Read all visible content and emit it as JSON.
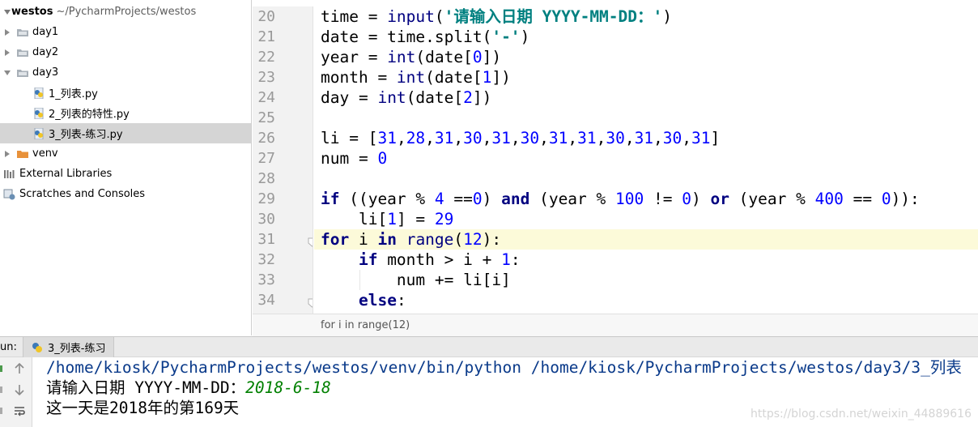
{
  "project": {
    "root_name": "westos",
    "root_path": "~/PycharmProjects/westos",
    "items": [
      {
        "label": "day1"
      },
      {
        "label": "day2"
      },
      {
        "label": "day3"
      },
      {
        "label": "1_列表.py"
      },
      {
        "label": "2_列表的特性.py"
      },
      {
        "label": "3_列表-练习.py"
      },
      {
        "label": "venv"
      },
      {
        "label": "External Libraries"
      },
      {
        "label": "Scratches and Consoles"
      }
    ]
  },
  "editor": {
    "line_numbers": [
      "20",
      "21",
      "22",
      "23",
      "24",
      "25",
      "26",
      "27",
      "28",
      "29",
      "30",
      "31",
      "32",
      "33",
      "34"
    ],
    "current_line": "31",
    "breadcrumb": "for i in range(12)"
  },
  "run": {
    "label": "un:",
    "tab_label": "3_列表-练习",
    "console": {
      "command": "/home/kiosk/PycharmProjects/westos/venv/bin/python /home/kiosk/PycharmProjects/westos/day3/3_列表",
      "prompt": "请输入日期 YYYY-MM-DD：",
      "user_input": "2018-6-18",
      "result": "这一天是2018年的第169天"
    }
  },
  "watermark": "https://blog.csdn.net/weixin_44889616",
  "colors": {
    "keyword": "#000080",
    "number": "#0000ff",
    "string": "#008080",
    "current_line": "#fcfad9",
    "console_path": "#0a3a8a",
    "console_input": "#008000"
  }
}
